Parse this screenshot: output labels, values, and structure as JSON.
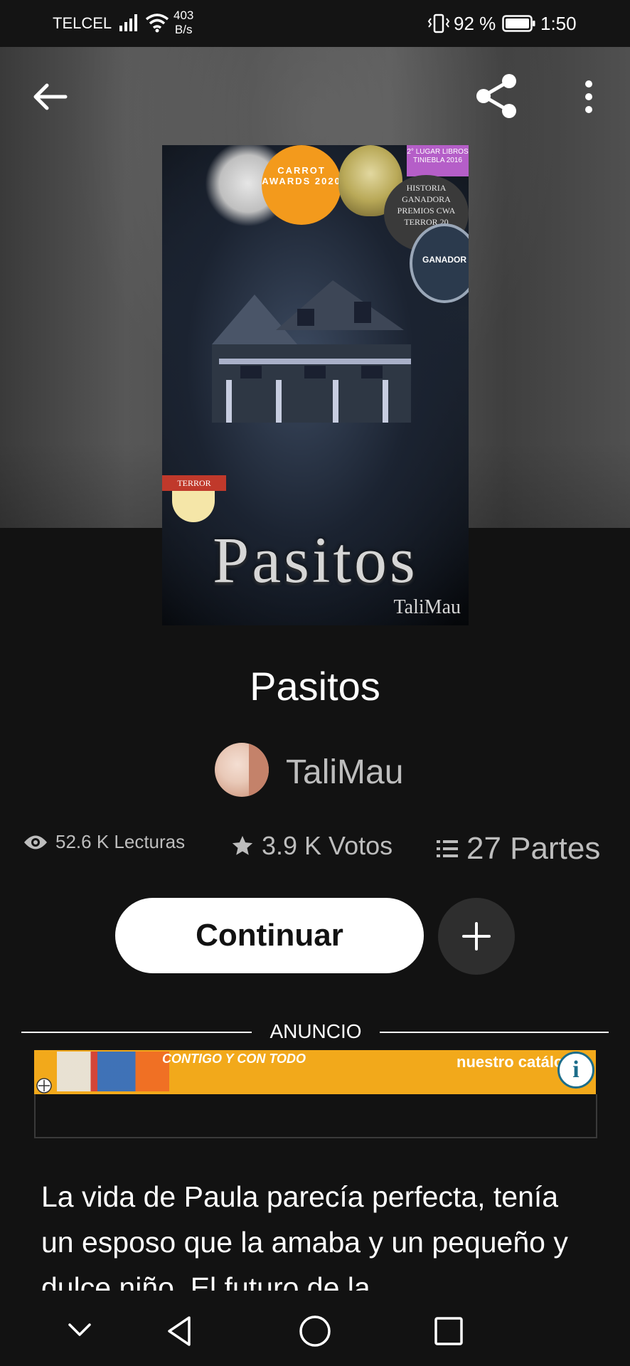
{
  "status_bar": {
    "carrier": "TELCEL",
    "net_speed_value": "403",
    "net_speed_unit": "B/s",
    "battery_percent": "92 %",
    "time": "1:50"
  },
  "cover": {
    "badge_orange": "CARROT AWARDS 2020",
    "badge_purple": "2° LUGAR LIBROS TINIEBLA 2016",
    "seal_text": "HISTORIA GANADORA PREMIOS CWA TERROR 20",
    "seal2_text": "GANADOR",
    "title": "Pasitos",
    "author": "TaliMau",
    "terror_badge": "TERROR"
  },
  "story": {
    "title": "Pasitos",
    "author": "TaliMau"
  },
  "stats": {
    "reads": "52.6 K Lecturas",
    "votes": "3.9 K Votos",
    "parts": "27 Partes"
  },
  "actions": {
    "continue_label": "Continuar"
  },
  "ad": {
    "label": "ANUNCIO",
    "text_left": "CONTIGO Y CON TODO",
    "text_right": "nuestro catálo",
    "info": "i"
  },
  "description": {
    "text": "La vida de Paula parecía perfecta, tenía un esposo que la amaba y un pequeño y dulce niño. El futuro de la"
  },
  "icons": {
    "back": "arrow-left-icon",
    "share": "share-icon",
    "more": "more-vertical-icon",
    "eye": "eye-icon",
    "star": "star-icon",
    "list": "list-icon",
    "add": "plus-icon"
  }
}
